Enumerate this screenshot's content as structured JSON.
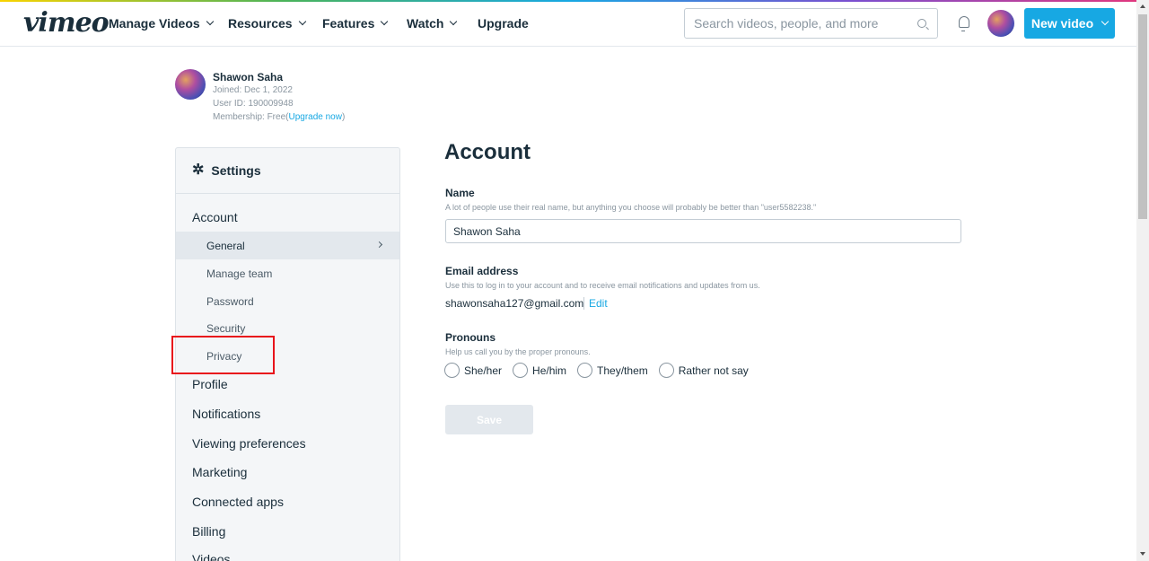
{
  "header": {
    "logo": "vimeo",
    "nav": [
      {
        "label": "Manage Videos",
        "has_dropdown": true
      },
      {
        "label": "Resources",
        "has_dropdown": true
      },
      {
        "label": "Features",
        "has_dropdown": true
      },
      {
        "label": "Watch",
        "has_dropdown": true
      },
      {
        "label": "Upgrade",
        "has_dropdown": false
      }
    ],
    "search_placeholder": "Search videos, people, and more",
    "new_video_label": "New video",
    "accent_color": "#17a8e3"
  },
  "profile": {
    "name": "Shawon Saha",
    "joined": "Joined: Dec 1, 2022",
    "user_id": "User ID: 190009948",
    "membership_prefix": "Membership: Free(",
    "upgrade_link": "Upgrade now",
    "membership_suffix": ")"
  },
  "sidebar": {
    "title": "Settings",
    "sections": {
      "account": "Account",
      "profile": "Profile",
      "notifications": "Notifications",
      "viewing": "Viewing preferences",
      "marketing": "Marketing",
      "connected": "Connected apps",
      "billing": "Billing",
      "videos": "Videos"
    },
    "account_items": {
      "general": "General",
      "manage_team": "Manage team",
      "password": "Password",
      "security": "Security",
      "privacy": "Privacy"
    },
    "active_item": "General",
    "highlighted_item": "Privacy"
  },
  "main": {
    "title": "Account",
    "name": {
      "label": "Name",
      "help": "A lot of people use their real name, but anything you choose will probably be better than \"user5582238.\"",
      "value": "Shawon Saha"
    },
    "email": {
      "label": "Email address",
      "help": "Use this to log in to your account and to receive email notifications and updates from us.",
      "value": "shawonsaha127@gmail.com",
      "edit_label": "Edit"
    },
    "pronouns": {
      "label": "Pronouns",
      "help": "Help us call you by the proper pronouns.",
      "options": [
        "She/her",
        "He/him",
        "They/them",
        "Rather not say"
      ],
      "selected": null
    },
    "save_label": "Save"
  }
}
